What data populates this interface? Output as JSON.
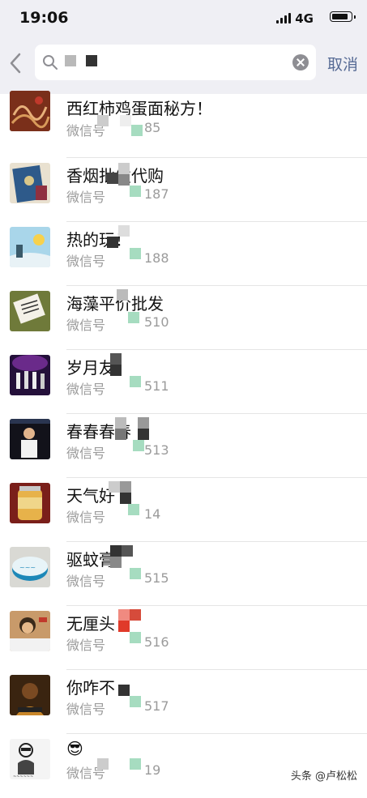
{
  "status": {
    "time": "19:06",
    "network": "4G"
  },
  "search": {
    "cancel_label": "取消"
  },
  "results": [
    {
      "name": "西红柿鸡蛋面秘方！",
      "sub": "微信号",
      "tail": "85",
      "avatar_color": "#8a3a22"
    },
    {
      "name": "香烟批发代购",
      "sub": "微信号",
      "tail": "187",
      "avatar_color": "#2e5a8a"
    },
    {
      "name": "热的玩！",
      "sub": "微信号",
      "tail": "188",
      "avatar_color": "#9fd0e6"
    },
    {
      "name": "海藻平价批发",
      "sub": "微信号",
      "tail": "510",
      "avatar_color": "#6f7a3a"
    },
    {
      "name": "岁月友",
      "sub": "微信号",
      "tail": "511",
      "avatar_color": "#2a0c3e"
    },
    {
      "name": "春春春春",
      "sub": "微信号",
      "tail": "513",
      "avatar_color": "#1a1a2a"
    },
    {
      "name": "天气好",
      "sub": "微信号",
      "tail": "14",
      "avatar_color": "#c48a3a"
    },
    {
      "name": "驱蚊膏",
      "sub": "微信号",
      "tail": "515",
      "avatar_color": "#d7e3e6"
    },
    {
      "name": "无厘头",
      "sub": "微信号",
      "tail": "516",
      "avatar_color": "#b07a4a"
    },
    {
      "name": "你咋不",
      "sub": "微信号",
      "tail": "517",
      "avatar_color": "#5a3a1a"
    },
    {
      "name": "😎",
      "sub": "微信号",
      "tail": "19",
      "avatar_color": "#f2f2f2"
    }
  ],
  "watermark": "头条 @卢松松"
}
